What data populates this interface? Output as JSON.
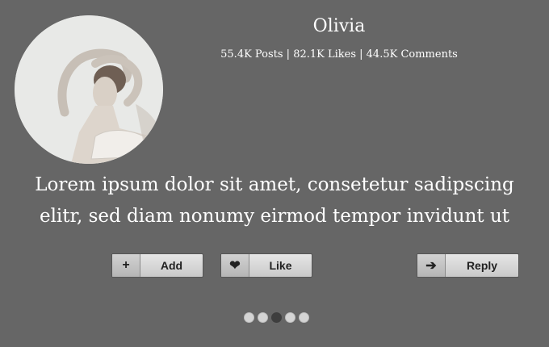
{
  "profile": {
    "name": "Olivia",
    "stats": "55.4K Posts | 82.1K Likes | 44.5K Comments"
  },
  "quote": {
    "line1": "Lorem ipsum dolor sit amet, consetetur sadipscing",
    "line2": "elitr, sed diam nonumy eirmod tempor invidunt ut"
  },
  "buttons": {
    "add": {
      "icon": "plus-icon",
      "icon_glyph": "+",
      "label": "Add"
    },
    "like": {
      "icon": "heart-icon",
      "icon_glyph": "❤",
      "label": "Like"
    },
    "reply": {
      "icon": "arrow-right-icon",
      "icon_glyph": "➔",
      "label": "Reply"
    }
  },
  "pagination": {
    "count": 5,
    "active_index": 2
  },
  "colors": {
    "background": "#666666",
    "text": "#ffffff",
    "active_dot": "#3e3e3e"
  }
}
